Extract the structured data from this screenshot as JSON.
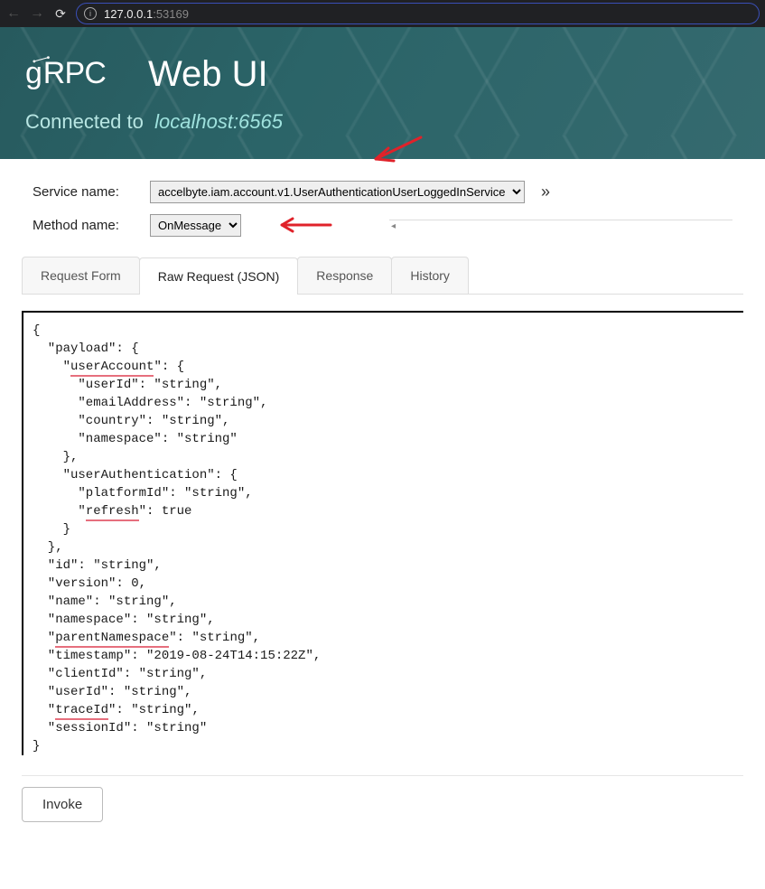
{
  "browser": {
    "url_host": "127.0.0.1",
    "url_port": ":53169"
  },
  "header": {
    "logo_text": "gRPC",
    "title": "Web UI",
    "connected_label": "Connected to",
    "endpoint": "localhost:6565"
  },
  "form": {
    "service_label": "Service name:",
    "service_value": "accelbyte.iam.account.v1.UserAuthenticationUserLoggedInService",
    "method_label": "Method name:",
    "method_value": "OnMessage",
    "expand_symbol": "»"
  },
  "tabs": [
    {
      "label": "Request Form",
      "active": false
    },
    {
      "label": "Raw Request (JSON)",
      "active": true
    },
    {
      "label": "Response",
      "active": false
    },
    {
      "label": "History",
      "active": false
    }
  ],
  "request_json": {
    "payload": {
      "userAccount": {
        "userId": "string",
        "emailAddress": "string",
        "country": "string",
        "namespace": "string"
      },
      "userAuthentication": {
        "platformId": "string",
        "refresh": true
      }
    },
    "id": "string",
    "version": 0,
    "name": "string",
    "namespace": "string",
    "parentNamespace": "string",
    "timestamp": "2019-08-24T14:15:22Z",
    "clientId": "string",
    "userId": "string",
    "traceId": "string",
    "sessionId": "string"
  },
  "underlined_keys": [
    "userAccount",
    "refresh",
    "parentNamespace",
    "traceId"
  ],
  "invoke_label": "Invoke"
}
